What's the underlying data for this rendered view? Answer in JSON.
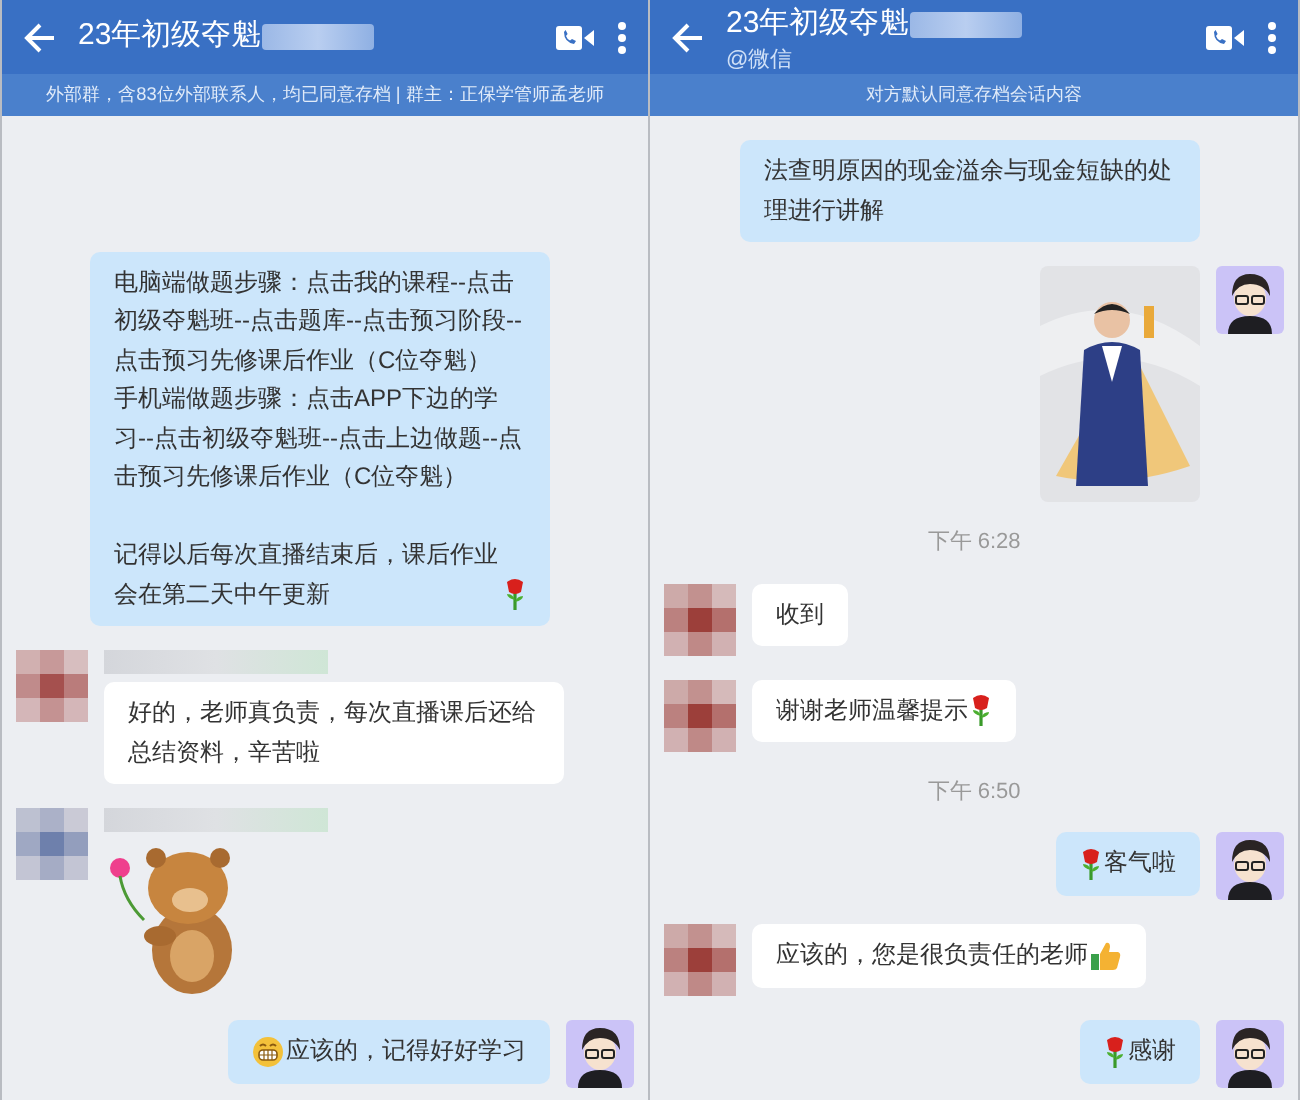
{
  "panes": [
    {
      "title": "23年初级夺魁",
      "title_blurred": true,
      "notice": "外部群，含83位外部联系人，均已同意存档 | 群主：正保学管师孟老师",
      "messages": [
        {
          "kind": "sent_text",
          "avatar": false,
          "paragraphs": [
            {
              "kind": "line",
              "parts": [
                {
                  "kind": "text",
                  "text": "电脑端做题步骤：点击我的课程--点击初级夺魁班--点击题库--点击预习阶段--点击预习先修课后作业（C位夺魁）"
                }
              ]
            },
            {
              "kind": "line",
              "parts": [
                {
                  "kind": "text",
                  "text": "手机端做题步骤：点击APP下边的学习--点击初级夺魁班--点击上边做题--点击预习先修课后作业（C位夺魁）"
                }
              ]
            },
            {
              "kind": "blank"
            },
            {
              "kind": "line",
              "parts": [
                {
                  "kind": "text",
                  "text": "记得以后每次直播结束后，课后作业会在第二天中午更新"
                },
                {
                  "kind": "rose"
                }
              ]
            }
          ]
        },
        {
          "kind": "received_text",
          "avatar": true,
          "color": "#a5504e",
          "blurred_name": true,
          "paragraphs": [
            {
              "kind": "line",
              "parts": [
                {
                  "kind": "text",
                  "text": "好的，老师真负责，每次直播课后还给总结资料，辛苦啦"
                }
              ]
            }
          ]
        },
        {
          "kind": "received_sticker",
          "avatar": true,
          "color": "#6e80ac",
          "blurred_name": true
        },
        {
          "kind": "sent_text",
          "avatar": true,
          "paragraphs": [
            {
              "kind": "line",
              "parts": [
                {
                  "kind": "grin"
                },
                {
                  "kind": "text",
                  "text": "应该的，记得好好学习"
                }
              ]
            }
          ]
        }
      ]
    },
    {
      "title": "23年初级夺魁",
      "title_blurred": true,
      "subtitle": "@微信",
      "notice": "对方默认同意存档会话内容",
      "messages": [
        {
          "kind": "sent_text",
          "avatar": false,
          "paragraphs": [
            {
              "kind": "line",
              "parts": [
                {
                  "kind": "text",
                  "text": "法查明原因的现金溢余与现金短缺的处理进行讲解"
                }
              ]
            }
          ]
        },
        {
          "kind": "sent_photo",
          "avatar": true
        },
        {
          "kind": "time",
          "text": "下午 6:28"
        },
        {
          "kind": "received_text",
          "avatar": true,
          "color": "#9c3f3a",
          "blurred_name": false,
          "paragraphs": [
            {
              "kind": "line",
              "parts": [
                {
                  "kind": "text",
                  "text": "收到"
                }
              ]
            }
          ]
        },
        {
          "kind": "received_text",
          "avatar": true,
          "color": "#9c3f3a",
          "blurred_name": false,
          "paragraphs": [
            {
              "kind": "line",
              "parts": [
                {
                  "kind": "text",
                  "text": "谢谢老师温馨提示"
                },
                {
                  "kind": "rose"
                }
              ]
            }
          ]
        },
        {
          "kind": "time",
          "text": "下午 6:50"
        },
        {
          "kind": "sent_text",
          "avatar": true,
          "paragraphs": [
            {
              "kind": "line",
              "parts": [
                {
                  "kind": "rose"
                },
                {
                  "kind": "text",
                  "text": "客气啦"
                }
              ]
            }
          ]
        },
        {
          "kind": "received_text",
          "avatar": true,
          "color": "#9c3f3a",
          "blurred_name": false,
          "paragraphs": [
            {
              "kind": "line",
              "parts": [
                {
                  "kind": "text",
                  "text": "应该的，您是很负责任的老师"
                },
                {
                  "kind": "thumbs"
                }
              ]
            }
          ]
        },
        {
          "kind": "sent_text",
          "avatar": true,
          "paragraphs": [
            {
              "kind": "line",
              "parts": [
                {
                  "kind": "rose"
                },
                {
                  "kind": "text",
                  "text": "感谢"
                }
              ]
            }
          ]
        }
      ]
    }
  ]
}
